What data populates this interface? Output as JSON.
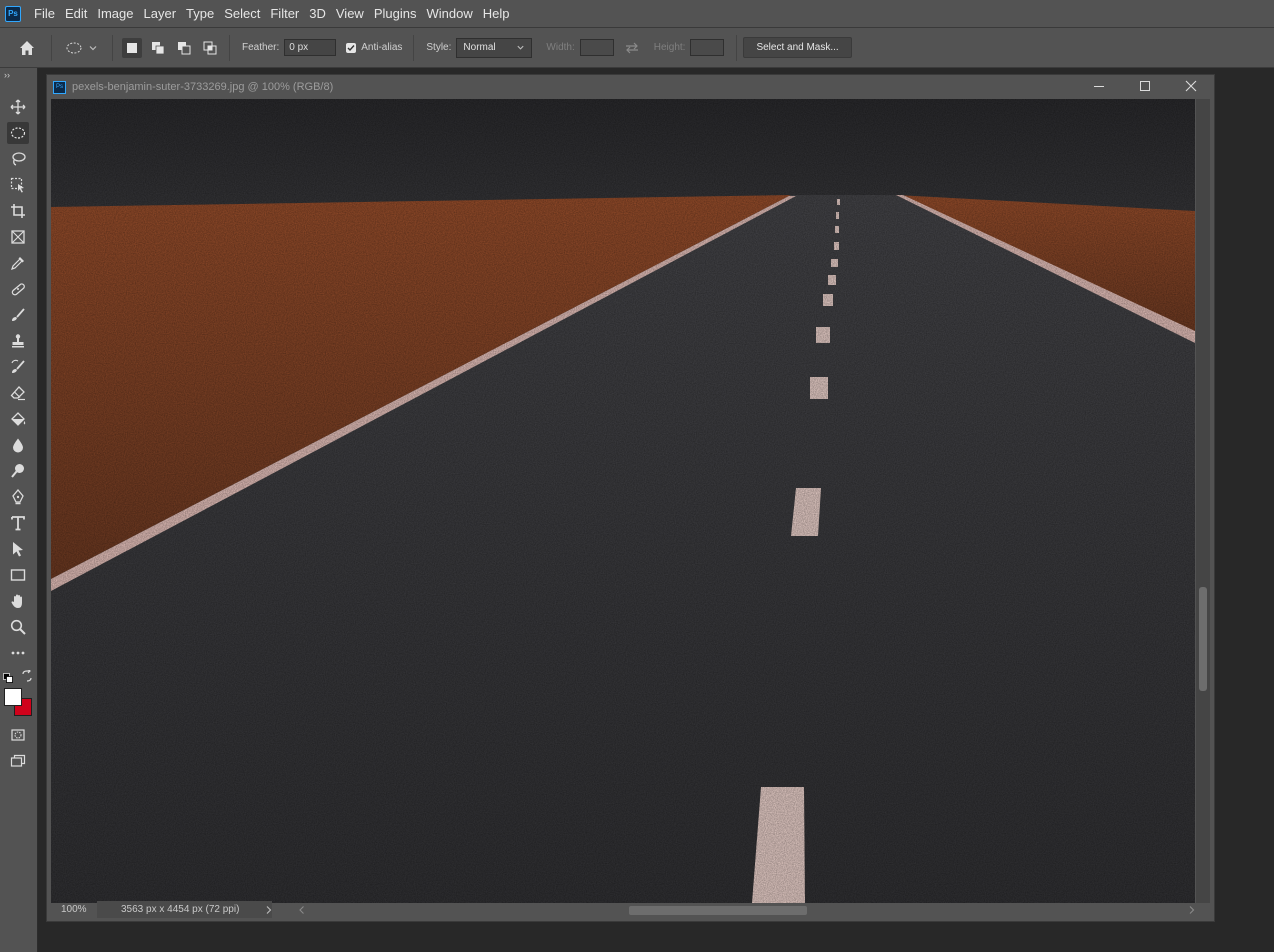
{
  "menubar": {
    "app_icon_label": "Ps",
    "items": [
      "File",
      "Edit",
      "Image",
      "Layer",
      "Type",
      "Select",
      "Filter",
      "3D",
      "View",
      "Plugins",
      "Window",
      "Help"
    ]
  },
  "options": {
    "feather_label": "Feather:",
    "feather_value": "0 px",
    "antialias_label": "Anti-alias",
    "antialias_checked": true,
    "style_label": "Style:",
    "style_value": "Normal",
    "width_label": "Width:",
    "height_label": "Height:",
    "select_mask_label": "Select and Mask..."
  },
  "toolbar": {
    "collapse_glyph": "››",
    "tools": [
      {
        "name": "move-tool",
        "icon": "move-icon",
        "active": false
      },
      {
        "name": "elliptical-marquee-tool",
        "icon": "ellipse-marquee-icon",
        "active": true
      },
      {
        "name": "lasso-tool",
        "icon": "lasso-icon",
        "active": false
      },
      {
        "name": "object-selection-tool",
        "icon": "object-selection-icon",
        "active": false
      },
      {
        "name": "crop-tool",
        "icon": "crop-icon",
        "active": false
      },
      {
        "name": "frame-tool",
        "icon": "frame-icon",
        "active": false
      },
      {
        "name": "eyedropper-tool",
        "icon": "eyedropper-icon",
        "active": false
      },
      {
        "name": "healing-brush-tool",
        "icon": "bandage-icon",
        "active": false
      },
      {
        "name": "brush-tool",
        "icon": "brush-icon",
        "active": false
      },
      {
        "name": "clone-stamp-tool",
        "icon": "stamp-icon",
        "active": false
      },
      {
        "name": "history-brush-tool",
        "icon": "history-brush-icon",
        "active": false
      },
      {
        "name": "eraser-tool",
        "icon": "eraser-icon",
        "active": false
      },
      {
        "name": "paint-bucket-tool",
        "icon": "bucket-icon",
        "active": false
      },
      {
        "name": "blur-tool",
        "icon": "drop-icon",
        "active": false
      },
      {
        "name": "dodge-tool",
        "icon": "dodge-icon",
        "active": false
      },
      {
        "name": "pen-tool",
        "icon": "pen-icon",
        "active": false
      },
      {
        "name": "type-tool",
        "icon": "type-icon",
        "active": false
      },
      {
        "name": "path-selection-tool",
        "icon": "arrow-icon",
        "active": false
      },
      {
        "name": "rectangle-tool",
        "icon": "rectangle-icon",
        "active": false
      },
      {
        "name": "hand-tool",
        "icon": "hand-icon",
        "active": false
      },
      {
        "name": "zoom-tool",
        "icon": "magnifier-icon",
        "active": false
      },
      {
        "name": "edit-toolbar",
        "icon": "more-icon",
        "active": false
      }
    ],
    "foreground_color": "#ffffff",
    "background_color": "#d0021b"
  },
  "document": {
    "title": "pexels-benjamin-suter-3733269.jpg @ 100% (RGB/8)",
    "zoom": "100%",
    "info": "3563 px x 4454 px (72 ppi)"
  },
  "colors": {
    "chrome": "#535353",
    "workspace": "#282828",
    "accent": "#31a8ff"
  }
}
